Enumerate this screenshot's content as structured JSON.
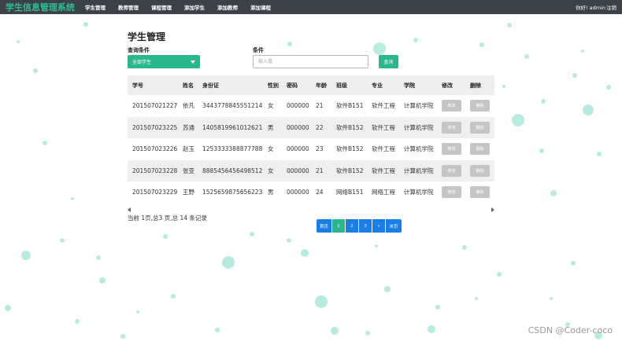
{
  "header": {
    "brand": "学生信息管理系统",
    "nav": [
      "学生管理",
      "教师管理",
      "课程管理",
      "添加学生",
      "添加教师",
      "添加课程"
    ],
    "greeting": "你好! admin",
    "logout": "注销"
  },
  "page": {
    "title": "学生管理"
  },
  "filters": {
    "query_label": "查询条件",
    "query_value": "全部学生",
    "condition_label": "条件",
    "condition_placeholder": "输入值",
    "query_button": "查询"
  },
  "table": {
    "columns": [
      "学号",
      "姓名",
      "身份证",
      "性别",
      "密码",
      "年龄",
      "班级",
      "专业",
      "学院",
      "修改",
      "删除"
    ],
    "rows": [
      [
        "201507021227",
        "依凡",
        "3443778845551214",
        "女",
        "000000",
        "21",
        "软件B151",
        "软件工程",
        "计算机学院"
      ],
      [
        "201507023225",
        "苏通",
        "1405819961012621",
        "男",
        "000000",
        "22",
        "软件B152",
        "软件工程",
        "计算机学院"
      ],
      [
        "201507023226",
        "赵玉",
        "1253333388877788",
        "女",
        "000000",
        "23",
        "软件B152",
        "软件工程",
        "计算机学院"
      ],
      [
        "201507023228",
        "张亚",
        "8885456456498512",
        "女",
        "000000",
        "21",
        "软件B152",
        "软件工程",
        "计算机学院"
      ],
      [
        "201507023229",
        "王野",
        "1525659875656223",
        "男",
        "000000",
        "24",
        "网络B151",
        "网络工程",
        "计算机学院"
      ]
    ],
    "edit_label": "修改",
    "delete_label": "删除"
  },
  "pagination": {
    "info": "当前 1页,总3 页,总 14 条记录",
    "first": "首页",
    "pages": [
      "1",
      "2",
      "3"
    ],
    "next": "»",
    "last": "末页",
    "current": "1"
  },
  "watermark": "CSDN @Coder-coco",
  "colors": {
    "navbar": "#3a4149",
    "brand": "#2fbf93",
    "accent": "#2ab78d",
    "pager": "#1a7ee6",
    "button_disabled": "#c5c5c5",
    "bubble": "#7fdcc6"
  }
}
